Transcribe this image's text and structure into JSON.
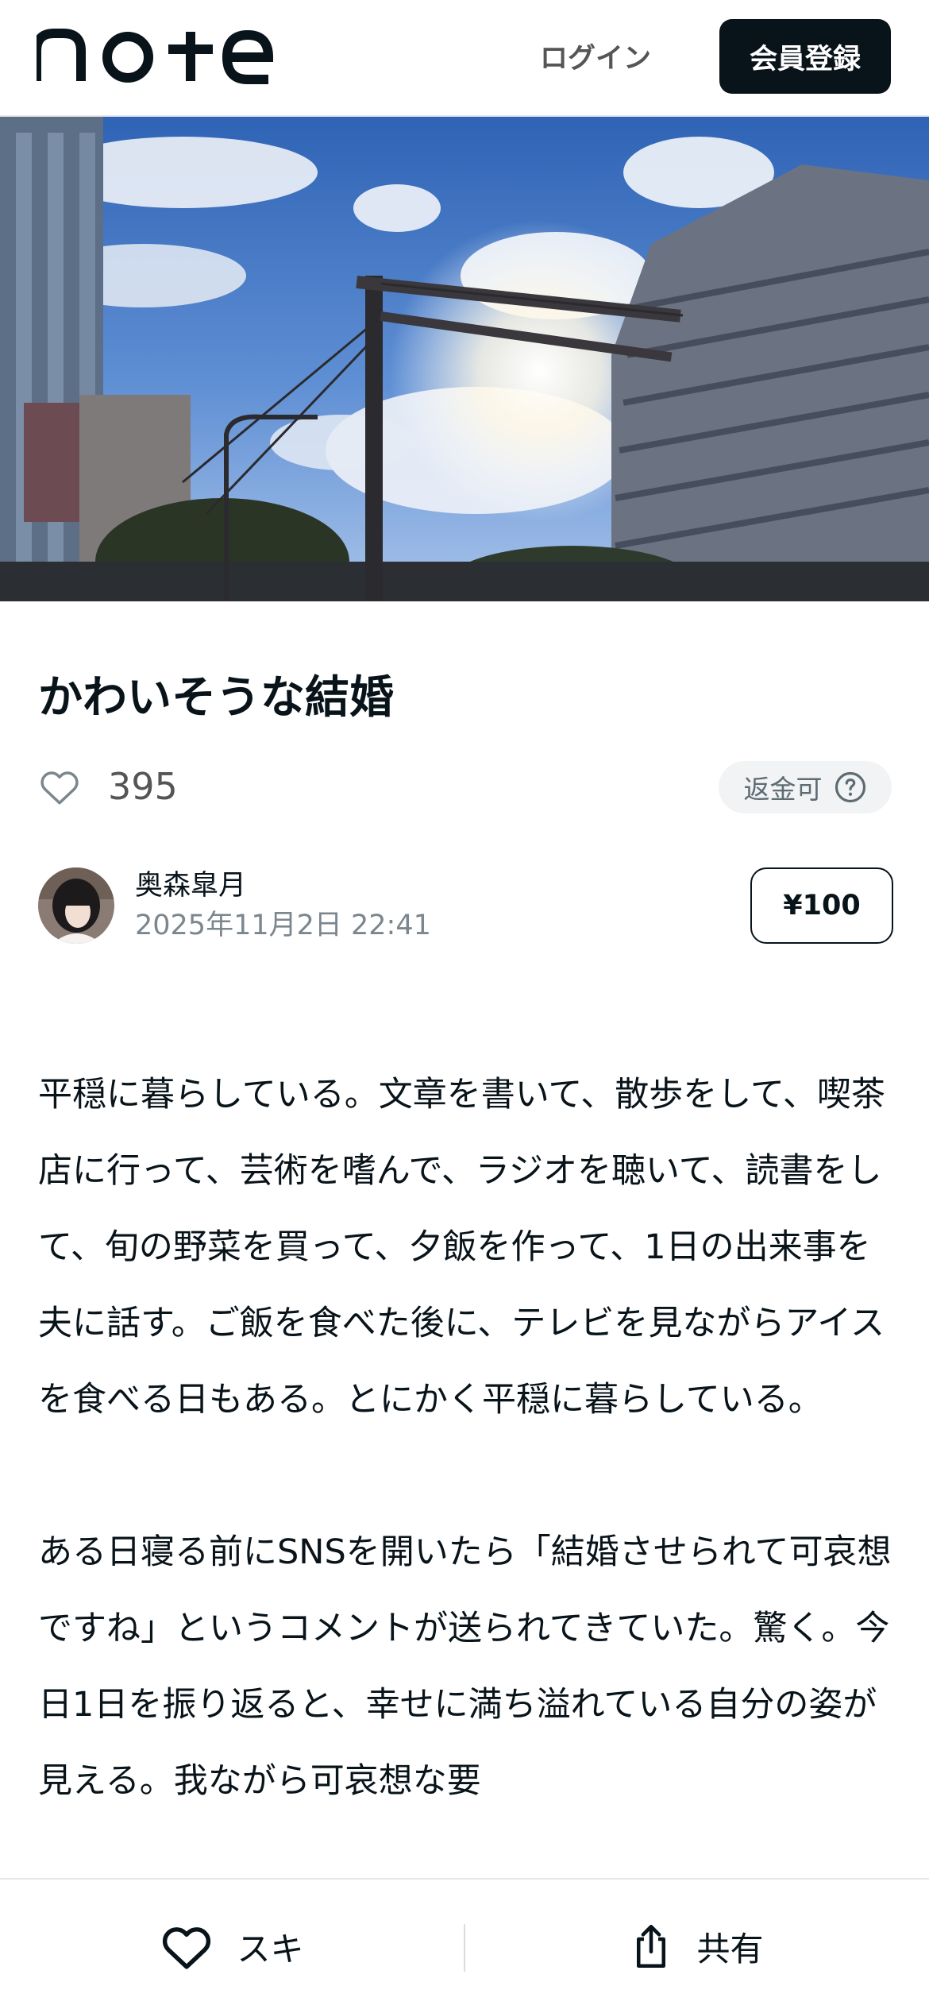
{
  "header": {
    "logo_text": "note",
    "login_label": "ログイン",
    "signup_label": "会員登録"
  },
  "article": {
    "title": "かわいそうな結婚",
    "like_count": "395",
    "refund_badge": "返金可",
    "author_name": "奥森皐月",
    "published_at": "2025年11月2日 22:41",
    "price": "¥100",
    "paragraphs": [
      "平穏に暮らしている。文章を書いて、散歩をして、喫茶店に行って、芸術を嗜んで、ラジオを聴いて、読書をして、旬の野菜を買って、夕飯を作って、1日の出来事を夫に話す。ご飯を食べた後に、テレビを見ながらアイスを食べる日もある。とにかく平穏に暮らしている。",
      "ある日寝る前にSNSを開いたら「結婚させられて可哀想ですね」というコメントが送られてきていた。驚く。今日1日を振り返ると、幸せに満ち溢れている自分の姿が見える。我ながら可哀想な要"
    ]
  },
  "bottom_bar": {
    "like_label": "スキ",
    "share_label": "共有"
  },
  "icons": {
    "like": "heart-outline-icon",
    "help": "question-circle-icon",
    "share": "share-icon"
  },
  "colors": {
    "primary_dark": "#08131a",
    "muted_text": "#7b868d",
    "badge_bg": "#f1f3f4"
  }
}
